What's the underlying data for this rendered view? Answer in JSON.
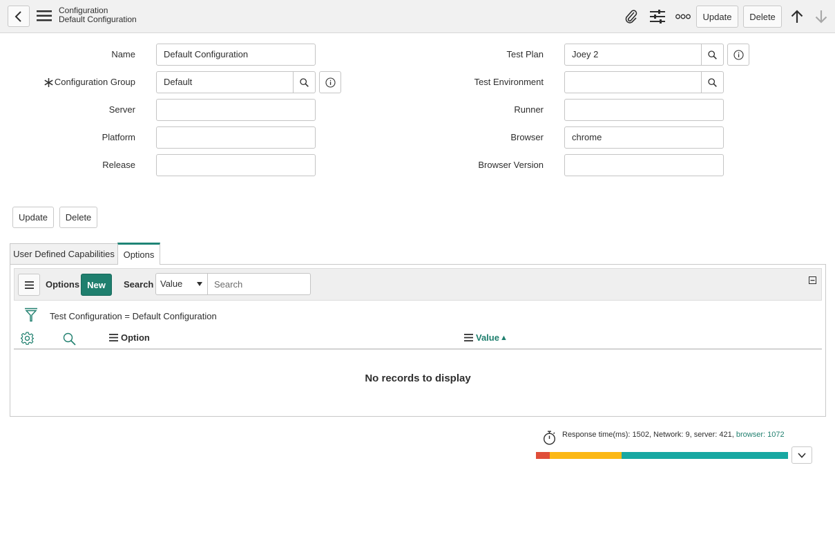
{
  "header": {
    "record_type": "Configuration",
    "record_name": "Default Configuration",
    "update_label": "Update",
    "delete_label": "Delete"
  },
  "form": {
    "left": [
      {
        "label": "Name",
        "value": "Default Configuration"
      },
      {
        "label": "Configuration Group",
        "value": "Default",
        "required": true
      },
      {
        "label": "Server",
        "value": ""
      },
      {
        "label": "Platform",
        "value": ""
      },
      {
        "label": "Release",
        "value": ""
      }
    ],
    "right": [
      {
        "label": "Test Plan",
        "value": "Joey 2"
      },
      {
        "label": "Test Environment",
        "value": ""
      },
      {
        "label": "Runner",
        "value": ""
      },
      {
        "label": "Browser",
        "value": "chrome"
      },
      {
        "label": "Browser Version",
        "value": ""
      }
    ],
    "update_label": "Update",
    "delete_label": "Delete"
  },
  "tabs": [
    {
      "label": "User Defined Capabilities",
      "active": false
    },
    {
      "label": "Options",
      "active": true
    }
  ],
  "list": {
    "title": "Options",
    "new_label": "New",
    "search_label": "Search",
    "search_field_selected": "Value",
    "search_placeholder": "Search",
    "filter_text": "Test Configuration = Default Configuration",
    "columns": [
      {
        "label": "Option",
        "sorted": false
      },
      {
        "label": "Value",
        "sorted": true,
        "sort_glyph": "▲"
      }
    ],
    "empty_text": "No records to display"
  },
  "response_time": {
    "prefix": "Response time(ms): 1502, Network: 9, server: 421,",
    "browser": "browser: 1072",
    "segments": [
      {
        "name": "network",
        "color": "#e04e39",
        "fraction": 0.055
      },
      {
        "name": "server",
        "color": "#fcb814",
        "fraction": 0.285
      },
      {
        "name": "browser",
        "color": "#17a8a2",
        "fraction": 0.66
      }
    ]
  },
  "colors": {
    "accent": "#1f7f6e",
    "link": "#1f7f6e"
  }
}
